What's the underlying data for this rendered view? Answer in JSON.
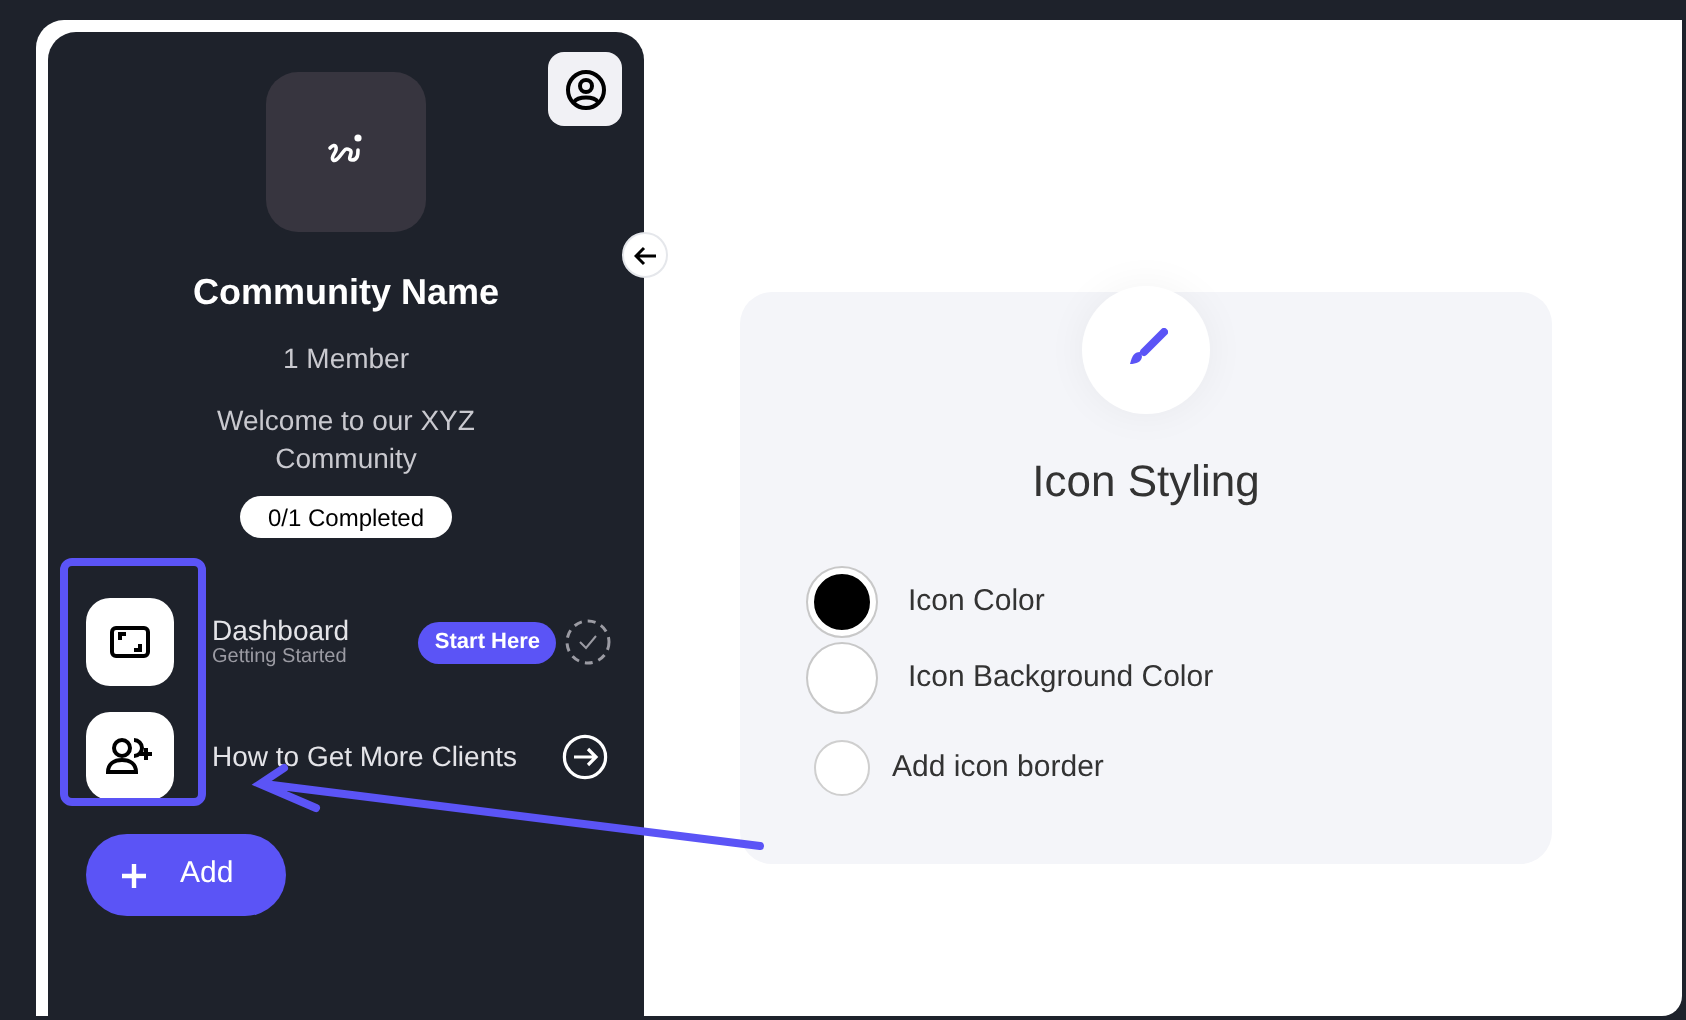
{
  "sidebar": {
    "community_name": "Community Name",
    "members": "1 Member",
    "welcome": "Welcome to our XYZ Community",
    "progress": "0/1 Completed",
    "items": [
      {
        "kind": "started",
        "title": "Dashboard",
        "subtitle": "Getting Started",
        "badge": "Start Here"
      },
      {
        "kind": "link",
        "title": "How to Get More Clients"
      }
    ],
    "add_button": "Add"
  },
  "panel": {
    "title": "Icon Styling",
    "colors": [
      {
        "label": "Icon Color",
        "color": "#000000"
      },
      {
        "label": "Icon Background Color",
        "color": "#ffffff"
      }
    ],
    "border_option": {
      "label": "Add icon border",
      "checked": false
    }
  }
}
